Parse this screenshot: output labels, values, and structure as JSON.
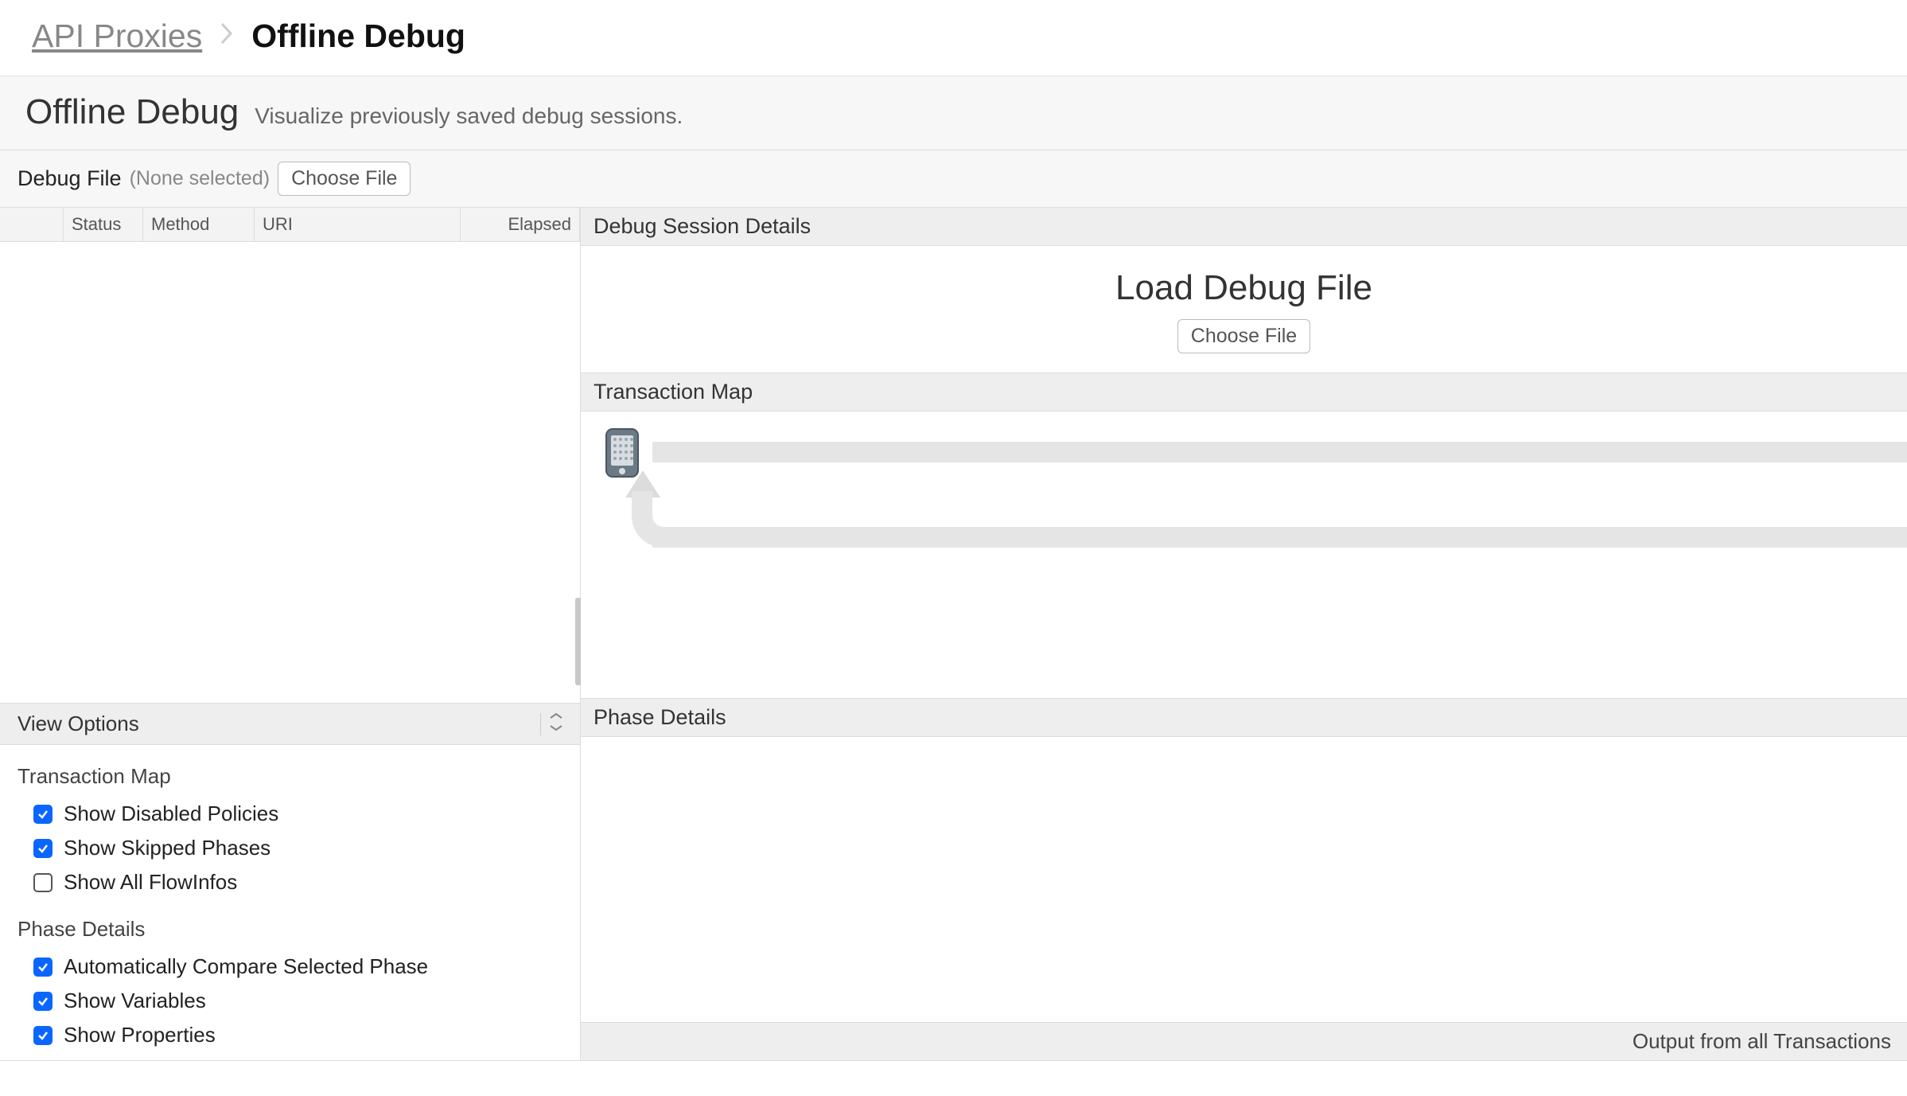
{
  "breadcrumb": {
    "root": "API Proxies",
    "current": "Offline Debug"
  },
  "title": {
    "heading": "Offline Debug",
    "subtitle": "Visualize previously saved debug sessions."
  },
  "debugFile": {
    "label": "Debug File",
    "none": "(None selected)",
    "choose": "Choose File"
  },
  "txTable": {
    "cols": {
      "status": "Status",
      "method": "Method",
      "uri": "URI",
      "elapsed": "Elapsed"
    }
  },
  "viewOptions": {
    "header": "View Options",
    "transactionMap": {
      "title": "Transaction Map",
      "opts": [
        {
          "label": "Show Disabled Policies",
          "checked": true
        },
        {
          "label": "Show Skipped Phases",
          "checked": true
        },
        {
          "label": "Show All FlowInfos",
          "checked": false
        }
      ]
    },
    "phaseDetails": {
      "title": "Phase Details",
      "opts": [
        {
          "label": "Automatically Compare Selected Phase",
          "checked": true
        },
        {
          "label": "Show Variables",
          "checked": true
        },
        {
          "label": "Show Properties",
          "checked": true
        }
      ]
    }
  },
  "right": {
    "sessionDetails": "Debug Session Details",
    "loadTitle": "Load Debug File",
    "loadChoose": "Choose File",
    "transactionMap": "Transaction Map",
    "phaseDetails": "Phase Details",
    "footer": "Output from all Transactions"
  }
}
